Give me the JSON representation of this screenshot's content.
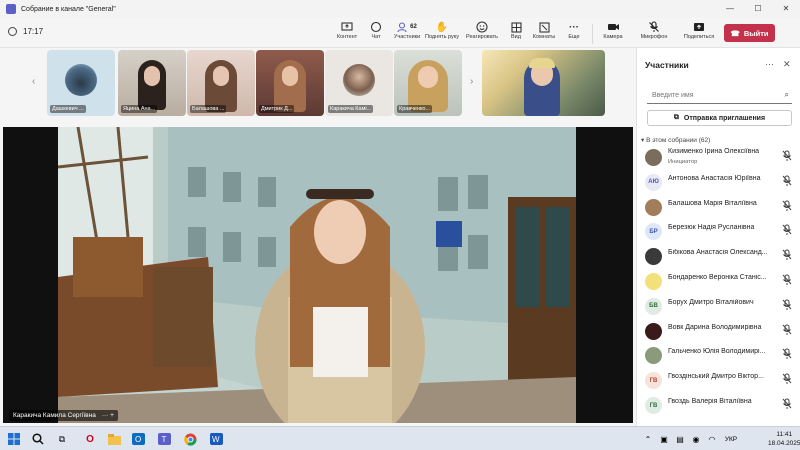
{
  "window": {
    "title": "Собрание в канале \"General\"",
    "min": "—",
    "max": "☐",
    "close": "✕"
  },
  "toolbar": {
    "timer": "17:17",
    "participant_count": "62",
    "buttons": [
      {
        "label": "Контент",
        "icon": "share-screen-icon"
      },
      {
        "label": "Чат",
        "icon": "chat-icon"
      },
      {
        "label": "Участники",
        "icon": "people-icon"
      },
      {
        "label": "Поднять руку",
        "icon": "hand-icon"
      },
      {
        "label": "Реагировать",
        "icon": "emoji-icon"
      },
      {
        "label": "Вид",
        "icon": "grid-icon"
      },
      {
        "label": "Комнаты",
        "icon": "rooms-icon"
      },
      {
        "label": "Еще",
        "icon": "more-icon"
      },
      {
        "label": "Камера",
        "icon": "camera-icon"
      },
      {
        "label": "Микрофон",
        "icon": "mic-off-icon"
      },
      {
        "label": "Поделиться",
        "icon": "share-icon"
      }
    ],
    "leave_label": "Выйти"
  },
  "strip": {
    "tiles": [
      {
        "name": "Дашкевич ..."
      },
      {
        "name": "Яцина Ана..."
      },
      {
        "name": "Балашова ..."
      },
      {
        "name": "Дмитрик Д..."
      },
      {
        "name": "Каракича Камі..."
      },
      {
        "name": "Кравченко..."
      },
      {
        "name": ""
      }
    ]
  },
  "main": {
    "caption": "Каракича Камила Сергіївна",
    "caption_icons": "··· +"
  },
  "panel": {
    "title": "Участники",
    "search_placeholder": "Введите имя",
    "invite_label": "Отправка приглашения",
    "section_label": "В этом собрании (62)",
    "participants": [
      {
        "name": "Кизименко Ірина Олексіївна",
        "role": "Инициатор",
        "initials": "",
        "bg": "#7a6d5e",
        "fg": "#ffffff"
      },
      {
        "name": "Антонова Анастасія Юріївна",
        "role": "",
        "initials": "АЮ",
        "bg": "#e6e8f4",
        "fg": "#4b53bc"
      },
      {
        "name": "Балашова Марія Віталіївна",
        "role": "",
        "initials": "",
        "bg": "#a37c5b",
        "fg": "#ffffff"
      },
      {
        "name": "Березюк Надія Русланівна",
        "role": "",
        "initials": "БР",
        "bg": "#dfe6f7",
        "fg": "#3b5ba8"
      },
      {
        "name": "Бібікова Анастасія Олександ...",
        "role": "",
        "initials": "",
        "bg": "#3a3a3a",
        "fg": "#ffffff"
      },
      {
        "name": "Бондаренко Вероніка Станіс...",
        "role": "",
        "initials": "",
        "bg": "#f2e07a",
        "fg": "#ffffff"
      },
      {
        "name": "Борух Дмитро Віталійович",
        "role": "",
        "initials": "БВ",
        "bg": "#e0ece3",
        "fg": "#2f6b3f"
      },
      {
        "name": "Вовк Дарина Володимирівна",
        "role": "",
        "initials": "",
        "bg": "#3a1a1a",
        "fg": "#ffffff"
      },
      {
        "name": "Гальченко Юлія Володимирі...",
        "role": "",
        "initials": "",
        "bg": "#8b9a7c",
        "fg": "#ffffff"
      },
      {
        "name": "Гвоздінський Дмитро Віктор...",
        "role": "",
        "initials": "ГВ",
        "bg": "#f6e3dc",
        "fg": "#b2442a"
      },
      {
        "name": "Гвоздь Валерія Віталіївна",
        "role": "",
        "initials": "ГВ",
        "bg": "#e0ece3",
        "fg": "#2f6b3f"
      }
    ]
  },
  "taskbar": {
    "lang": "УКР",
    "time": "11:41",
    "date": "18.04.2025"
  },
  "colors": {
    "accent": "#5b5fc7",
    "leave": "#c4314b"
  }
}
